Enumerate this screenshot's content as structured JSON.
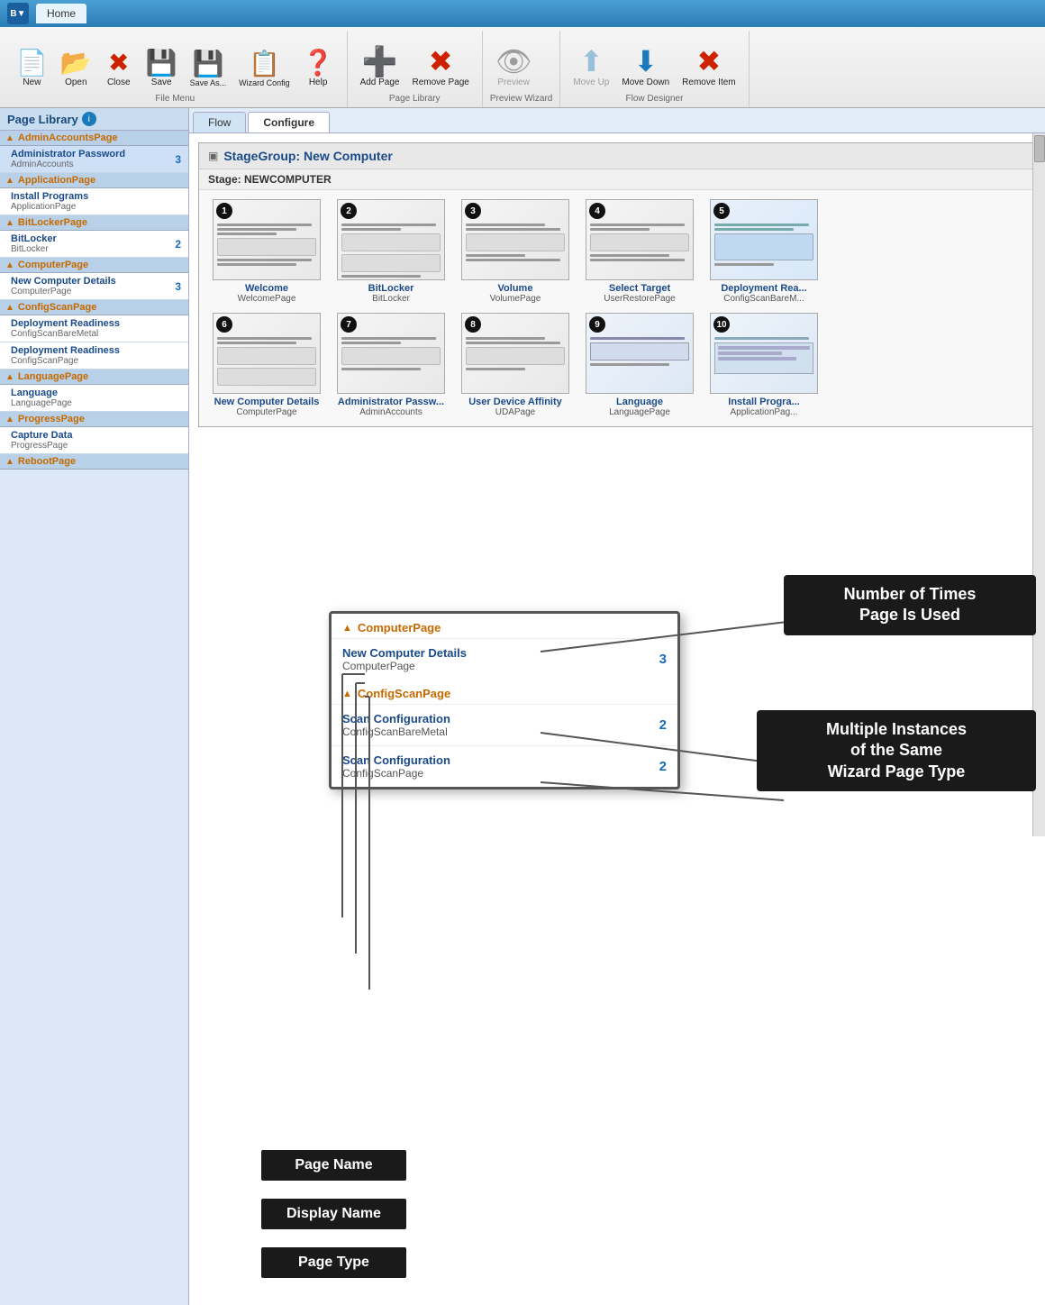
{
  "titlebar": {
    "logo": "B",
    "tab": "Home"
  },
  "ribbon": {
    "groups": [
      {
        "label": "File Menu",
        "buttons": [
          {
            "id": "new",
            "label": "New",
            "icon": "📄",
            "disabled": false
          },
          {
            "id": "open",
            "label": "Open",
            "icon": "📂",
            "disabled": false
          },
          {
            "id": "close",
            "label": "Close",
            "icon": "✖",
            "disabled": false
          },
          {
            "id": "save",
            "label": "Save",
            "icon": "💾",
            "disabled": false
          },
          {
            "id": "save-as",
            "label": "Save As...",
            "icon": "💾",
            "disabled": false
          },
          {
            "id": "wizard-config",
            "label": "Wizard Config",
            "icon": "📋",
            "disabled": false
          },
          {
            "id": "help",
            "label": "Help",
            "icon": "❓",
            "disabled": false
          }
        ]
      },
      {
        "label": "Page Library",
        "buttons": [
          {
            "id": "add-page",
            "label": "Add Page",
            "icon": "➕",
            "disabled": false
          },
          {
            "id": "remove-page",
            "label": "Remove Page",
            "icon": "✖",
            "disabled": false
          }
        ]
      },
      {
        "label": "Preview Wizard",
        "buttons": [
          {
            "id": "preview",
            "label": "Preview",
            "icon": "👁",
            "disabled": true
          }
        ]
      },
      {
        "label": "Flow Designer",
        "buttons": [
          {
            "id": "move-up",
            "label": "Move Up",
            "icon": "⬆",
            "disabled": true
          },
          {
            "id": "move-down",
            "label": "Move Down",
            "icon": "⬇",
            "disabled": false
          },
          {
            "id": "remove-item",
            "label": "Remove Item",
            "icon": "✖",
            "disabled": false
          }
        ]
      }
    ]
  },
  "sidebar": {
    "title": "Page Library",
    "groups": [
      {
        "name": "AdminAccountsPage",
        "items": [
          {
            "displayName": "Administrator Password",
            "typeName": "AdminAccounts",
            "count": "3"
          }
        ]
      },
      {
        "name": "ApplicationPage",
        "items": [
          {
            "displayName": "Install Programs",
            "typeName": "ApplicationPage",
            "count": ""
          }
        ]
      },
      {
        "name": "BitLockerPage",
        "items": [
          {
            "displayName": "BitLocker",
            "typeName": "BitLocker",
            "count": "2"
          }
        ]
      },
      {
        "name": "ComputerPage",
        "items": [
          {
            "displayName": "New Computer Details",
            "typeName": "ComputerPage",
            "count": "3"
          }
        ]
      },
      {
        "name": "ConfigScanPage",
        "items": [
          {
            "displayName": "Deployment Readiness",
            "typeName": "ConfigScanBareMetal",
            "count": ""
          },
          {
            "displayName": "Deployment Readiness",
            "typeName": "ConfigScanPage",
            "count": ""
          }
        ]
      },
      {
        "name": "LanguagePage",
        "items": [
          {
            "displayName": "Language",
            "typeName": "LanguagePage",
            "count": ""
          }
        ]
      },
      {
        "name": "ProgressPage",
        "items": [
          {
            "displayName": "Capture Data",
            "typeName": "ProgressPage",
            "count": ""
          }
        ]
      },
      {
        "name": "RebootPage",
        "items": []
      }
    ]
  },
  "tabs": [
    {
      "id": "flow",
      "label": "Flow",
      "active": false
    },
    {
      "id": "configure",
      "label": "Configure",
      "active": true
    }
  ],
  "stageGroup": {
    "title": "StageGroup: New Computer",
    "stageName": "Stage: NEWCOMPUTER",
    "pages_row1": [
      {
        "num": "1",
        "name": "Welcome",
        "type": "WelcomePage"
      },
      {
        "num": "2",
        "name": "BitLocker",
        "type": "BitLocker"
      },
      {
        "num": "3",
        "name": "Volume",
        "type": "VolumePage"
      },
      {
        "num": "4",
        "name": "Select Target",
        "type": "UserRestorePage"
      },
      {
        "num": "5",
        "name": "Deployment Rea...",
        "type": "ConfigScanBareM..."
      }
    ],
    "pages_row2": [
      {
        "num": "6",
        "name": "New Computer Details",
        "type": "ComputerPage"
      },
      {
        "num": "7",
        "name": "Administrator Passw...",
        "type": "AdminAccounts"
      },
      {
        "num": "8",
        "name": "User Device Affinity",
        "type": "UDAPage"
      },
      {
        "num": "9",
        "name": "Language",
        "type": "LanguagePage"
      },
      {
        "num": "10",
        "name": "Install Progra...",
        "type": "ApplicationPag..."
      }
    ]
  },
  "magnifiedPopup": {
    "groups": [
      {
        "name": "ComputerPage",
        "items": [
          {
            "displayName": "New Computer Details",
            "typeName": "ComputerPage",
            "count": "3"
          }
        ]
      },
      {
        "name": "ConfigScanPage",
        "items": [
          {
            "displayName": "Scan Configuration",
            "typeName": "ConfigScanBareMetal",
            "count": "2"
          },
          {
            "displayName": "Scan Configuration",
            "typeName": "ConfigScanPage",
            "count": "2"
          }
        ]
      }
    ]
  },
  "callouts": {
    "timesUsed": "Number of Times\nPage Is Used",
    "multipleInstances": "Multiple Instances\nof the Same\nWizard Page Type"
  },
  "annotationLabels": [
    "Page Name",
    "Display Name",
    "Page Type"
  ]
}
